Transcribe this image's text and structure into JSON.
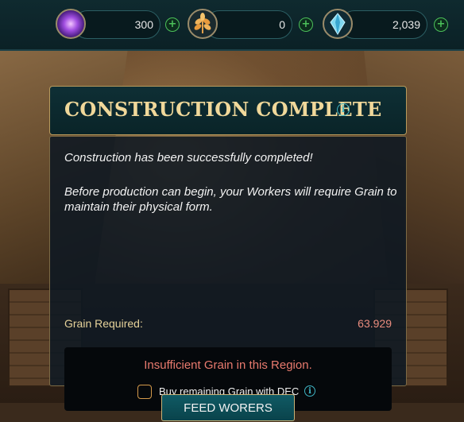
{
  "resources": [
    {
      "name": "energy-orb",
      "icon": "purple-orb-icon",
      "value": "300",
      "plus": "+"
    },
    {
      "name": "grain",
      "icon": "grain-leaf-icon",
      "value": "0",
      "plus": "+"
    },
    {
      "name": "crystal",
      "icon": "blue-crystal-icon",
      "value": "2,039",
      "plus": "+"
    }
  ],
  "dialog": {
    "title": "CONSTRUCTION COMPLETE",
    "info_icon": "i",
    "message1": "Construction has been successfully completed!",
    "message2": "Before production can begin, your Workers will require Grain to maintain their physical form.",
    "grain_label": "Grain Required:",
    "grain_value": "63.929",
    "warning": "Insufficient Grain in this Region.",
    "buy_label": "Buy remaining Grain with DEC",
    "button_label": "FEED WORERS"
  },
  "colors": {
    "title": "#f0d89a",
    "warning": "#e97a6e",
    "grain_value": "#e98c7e",
    "accent": "#3fb5c5",
    "button": "#0f5a64"
  }
}
